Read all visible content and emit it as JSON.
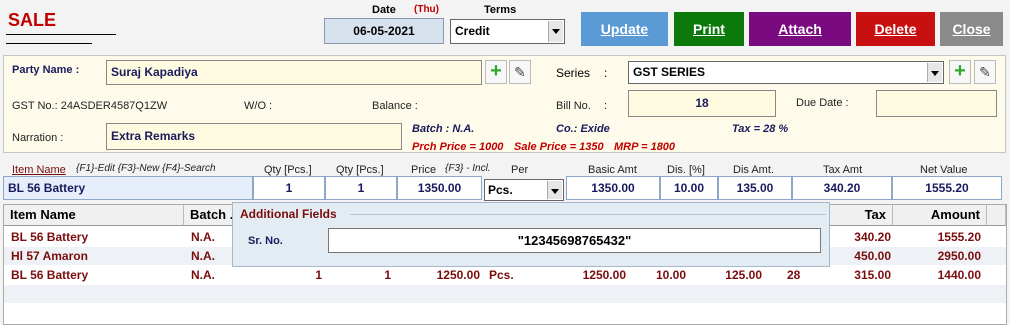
{
  "header": {
    "title": "SALE",
    "date_label": "Date",
    "day": "(Thu)",
    "date_value": "06-05-2021",
    "terms_label": "Terms",
    "terms_value": "Credit"
  },
  "buttons": {
    "update": "Update",
    "print": "Print",
    "attach": "Attach",
    "delete": "Delete",
    "close": "Close"
  },
  "party": {
    "party_label": "Party Name :",
    "party_value": "Suraj Kapadiya",
    "series_label": "Series",
    "series_colon": ":",
    "series_value": "GST SERIES",
    "gst_text": "GST No.: 24ASDER4587Q1ZW",
    "wo_label": "W/O :",
    "balance_label": "Balance :",
    "bill_label": "Bill No.",
    "bill_colon": ":",
    "bill_value": "18",
    "due_label": "Due Date :",
    "due_value": "",
    "narration_label": "Narration :",
    "narration_value": "Extra Remarks",
    "batch_info": "Batch : N.A.",
    "co_info": "Co.: Exide",
    "tax_info": "Tax = 28 %",
    "prch_info": "Prch Price = 1000",
    "sale_info": "Sale Price = 1350",
    "mrp_info": "MRP = 1800"
  },
  "entry": {
    "headers": {
      "item_name": "Item Name",
      "item_hint": "{F1}-Edit  {F3}-New  {F4}-Search",
      "qty1": "Qty [Pcs.]",
      "qty2": "Qty [Pcs.]",
      "price": "Price",
      "price_hint": "{F3} - Incl.",
      "per": "Per",
      "basic_amt": "Basic Amt",
      "dis_pct": "Dis. [%]",
      "dis_amt": "Dis Amt.",
      "tax_amt": "Tax Amt",
      "net_value": "Net Value"
    },
    "values": {
      "item": "BL 56 Battery",
      "qty1": "1",
      "qty2": "1",
      "price": "1350.00",
      "per": "Pcs.",
      "basic_amt": "1350.00",
      "dis_pct": "10.00",
      "dis_amt": "135.00",
      "tax_amt": "340.20",
      "net_value": "1555.20"
    }
  },
  "grid": {
    "columns": {
      "item_name": "Item Name",
      "batch": "Batch .",
      "tax": "Tax",
      "amount": "Amount"
    },
    "rows": [
      {
        "item": "BL 56 Battery",
        "batch": "N.A.",
        "q1": "",
        "q2": "",
        "price": "",
        "per": "",
        "basic": "",
        "dis": "",
        "disamt": "",
        "taxp": "",
        "tax": "340.20",
        "amount": "1555.20"
      },
      {
        "item": "Hl 57 Amaron",
        "batch": "N.A.",
        "q1": "",
        "q2": "",
        "price": "",
        "per": "",
        "basic": "",
        "dis": "",
        "disamt": "",
        "taxp": "",
        "tax": "450.00",
        "amount": "2950.00"
      },
      {
        "item": "BL 56 Battery",
        "batch": "N.A.",
        "q1": "1",
        "q2": "1",
        "price": "1250.00",
        "per": "Pcs.",
        "basic": "1250.00",
        "dis": "10.00",
        "disamt": "125.00",
        "taxp": "28",
        "tax": "315.00",
        "amount": "1440.00"
      }
    ]
  },
  "overlay": {
    "title": "Additional Fields",
    "sr_label": "Sr. No.",
    "sr_value": "\"12345698765432\""
  }
}
